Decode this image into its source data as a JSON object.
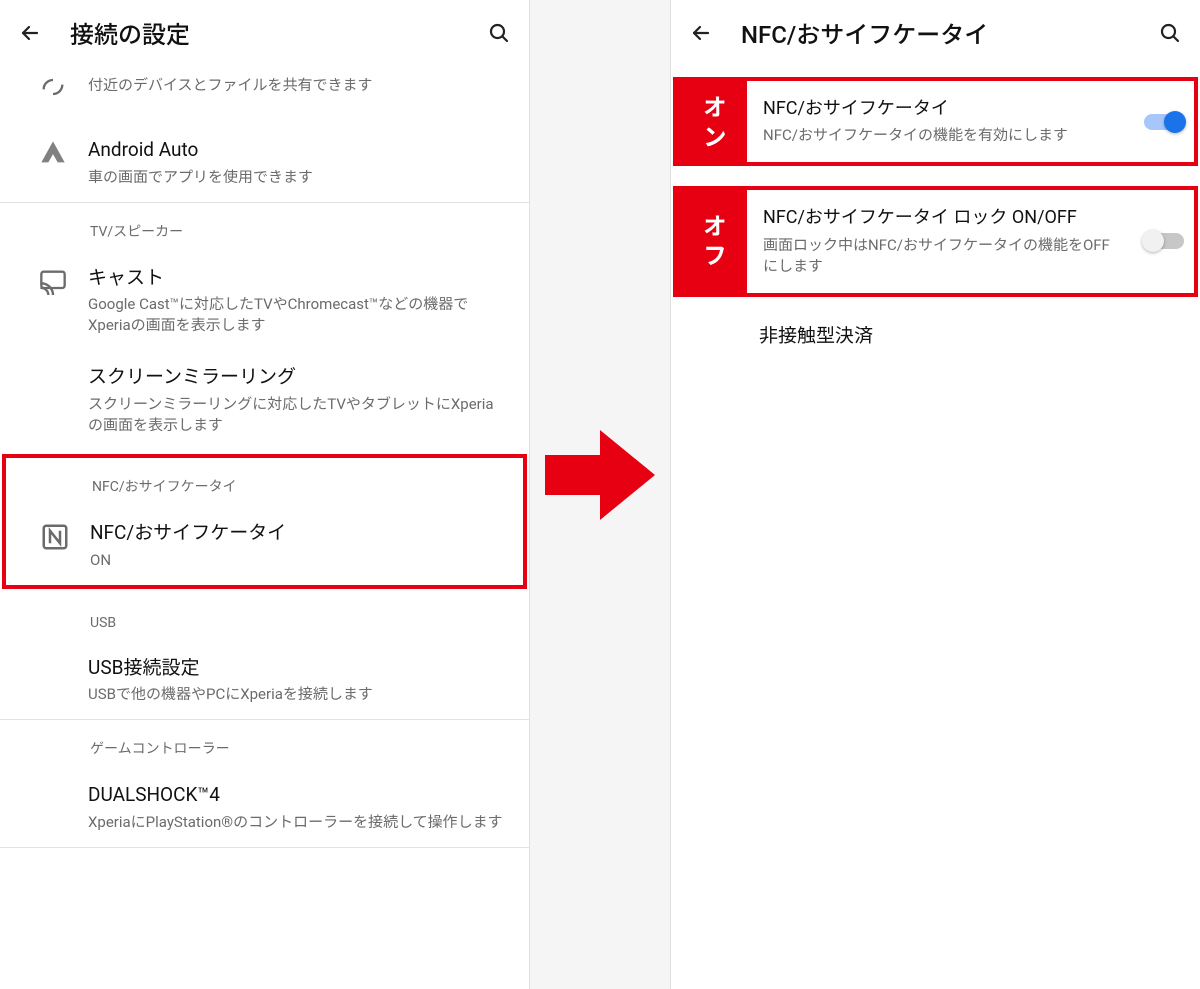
{
  "colors": {
    "accent": "#e60012",
    "switch_on": "#1a73e8"
  },
  "left": {
    "appbar": {
      "title": "接続の設定"
    },
    "row_nearby": {
      "sub": "付近のデバイスとファイルを共有できます"
    },
    "row_android_auto": {
      "title": "Android Auto",
      "sub": "車の画面でアプリを使用できます"
    },
    "section_tv": "TV/スピーカー",
    "row_cast": {
      "title": "キャスト",
      "sub": "Google Cast™に対応したTVやChromecast™などの機器でXperiaの画面を表示します"
    },
    "row_screen_mirroring": {
      "title": "スクリーンミラーリング",
      "sub": "スクリーンミラーリングに対応したTVやタブレットにXperiaの画面を表示します"
    },
    "section_nfc": "NFC/おサイフケータイ",
    "row_nfc": {
      "title": "NFC/おサイフケータイ",
      "sub": "ON"
    },
    "section_usb": "USB",
    "row_usb": {
      "title": "USB接続設定",
      "sub": "USBで他の機器やPCにXperiaを接続します"
    },
    "section_game": "ゲームコントローラー",
    "row_dualshock": {
      "title": "DUALSHOCK™4",
      "sub": "XperiaにPlayStation®のコントローラーを接続して操作します"
    }
  },
  "right": {
    "appbar": {
      "title": "NFC/おサイフケータイ"
    },
    "row_nfc_enable": {
      "badge": "オン",
      "title": "NFC/おサイフケータイ",
      "sub": "NFC/おサイフケータイの機能を有効にします",
      "state": "on"
    },
    "row_nfc_lock": {
      "badge": "オフ",
      "title": "NFC/おサイフケータイ ロック ON/OFF",
      "sub": "画面ロック中はNFC/おサイフケータイの機能をOFFにします",
      "state": "off"
    },
    "row_contactless": {
      "title": "非接触型決済"
    }
  }
}
